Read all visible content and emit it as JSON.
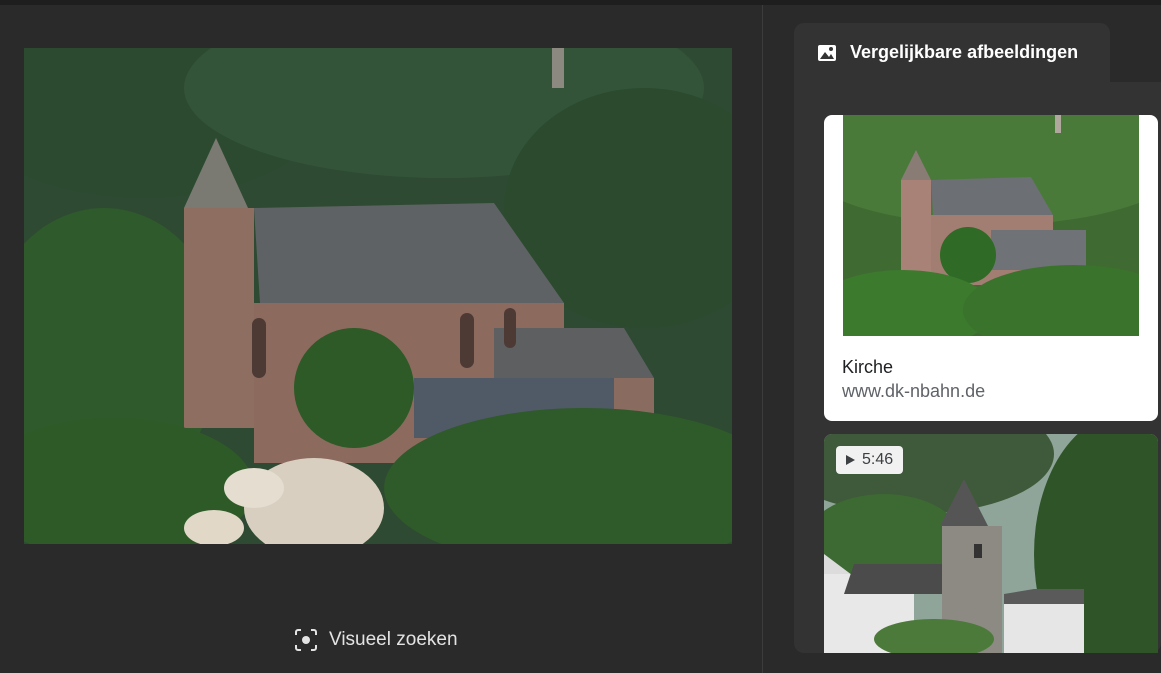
{
  "main": {
    "visual_search_label": "Visueel zoeken"
  },
  "sidebar": {
    "tab_label": "Vergelijkbare afbeeldingen",
    "results": [
      {
        "title": "Kirche",
        "source": "www.dk-nbahn.de"
      },
      {
        "duration": "5:46"
      }
    ]
  },
  "icons": {
    "tab": "image-icon",
    "visual_search": "lens-icon",
    "video": "play-icon"
  },
  "colors": {
    "background": "#2a2a2a",
    "panel": "#333333",
    "card": "#ffffff"
  }
}
